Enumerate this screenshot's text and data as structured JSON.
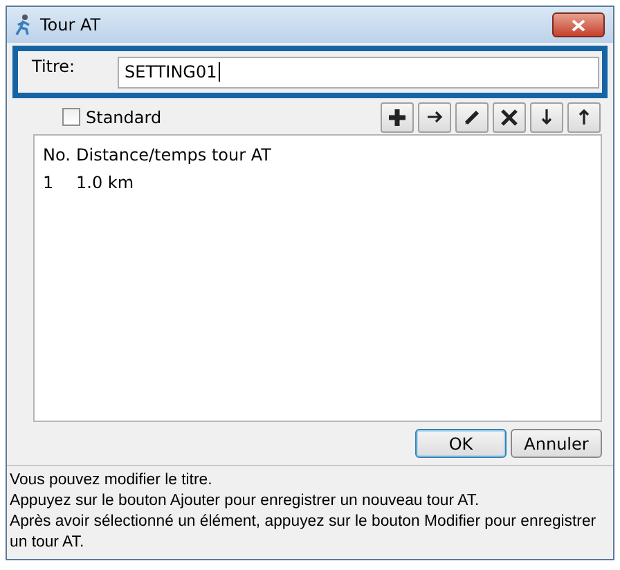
{
  "window": {
    "title": "Tour AT"
  },
  "title_field": {
    "label": "Titre:",
    "value": "SETTING01"
  },
  "standard": {
    "label": "Standard",
    "checked": false
  },
  "list": {
    "columns": [
      "No.",
      "Distance/temps tour AT"
    ],
    "rows": [
      {
        "cells": [
          "1",
          "1.0 km"
        ],
        "selected": false
      }
    ]
  },
  "buttons": [
    {
      "label": "OK",
      "kind": "default"
    },
    {
      "label": "Annuler",
      "kind": "normal"
    }
  ],
  "help": [
    "Vous pouvez modifier le titre.",
    "Appuyez sur le bouton Ajouter pour enregistrer un nouveau tour AT.",
    "Après avoir sélectionné un élément, appuyez sur le bouton Modifier pour enregistrer un tour AT."
  ]
}
